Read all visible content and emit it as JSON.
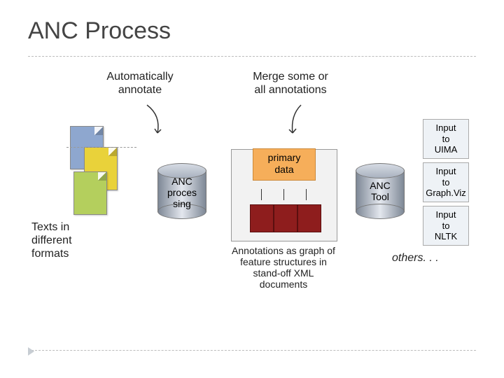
{
  "title": "ANC Process",
  "labels": {
    "auto_annotate": "Automatically\nannotate",
    "merge": "Merge some or\nall annotations",
    "texts_formats": "Texts in\ndifferent\nformats",
    "anc_processing": "ANC\nproces\nsing",
    "primary_data": "primary\ndata",
    "anc_tool": "ANC\nTool",
    "annotations_graph": "Annotations as graph of\nfeature structures in\nstand-off XML\ndocuments"
  },
  "outputs": {
    "uima": "Input\nto\nUIMA",
    "graphviz": "Input\nto\nGraph.Viz",
    "nltk": "Input\nto\nNLTK",
    "others": "others. . ."
  },
  "colors": {
    "doc_blue": "#8ea7cf",
    "doc_yellow": "#e9d23a",
    "doc_green": "#b4cf5d",
    "cyl_grad_outer": "#7e8896",
    "cyl_grad_inner": "#cfd5de",
    "out_bg": "#eef2f6"
  }
}
